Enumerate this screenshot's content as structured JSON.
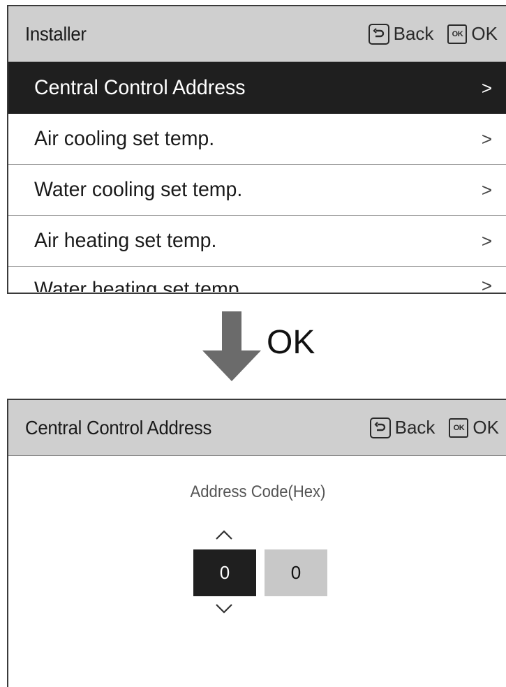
{
  "screen1": {
    "title": "Installer",
    "back_label": "Back",
    "ok_icon_text": "OK",
    "ok_label": "OK",
    "menu_items": [
      {
        "label": "Central Control Address",
        "selected": true
      },
      {
        "label": "Air cooling set temp."
      },
      {
        "label": "Water cooling set temp."
      },
      {
        "label": "Air heating set temp."
      },
      {
        "label": "Water heating set temp."
      }
    ],
    "chevron": ">"
  },
  "transition": {
    "label": "OK",
    "arrow_color": "#6b6b6b"
  },
  "screen2": {
    "title": "Central Control Address",
    "back_label": "Back",
    "ok_icon_text": "OK",
    "ok_label": "OK",
    "address_label": "Address Code(Hex)",
    "digits": [
      "0",
      "0"
    ],
    "active_digit_index": 0
  },
  "colors": {
    "header_bg": "#cfcfcf",
    "selected_bg": "#1f1f1f",
    "inactive_digit_bg": "#c8c8c8"
  }
}
